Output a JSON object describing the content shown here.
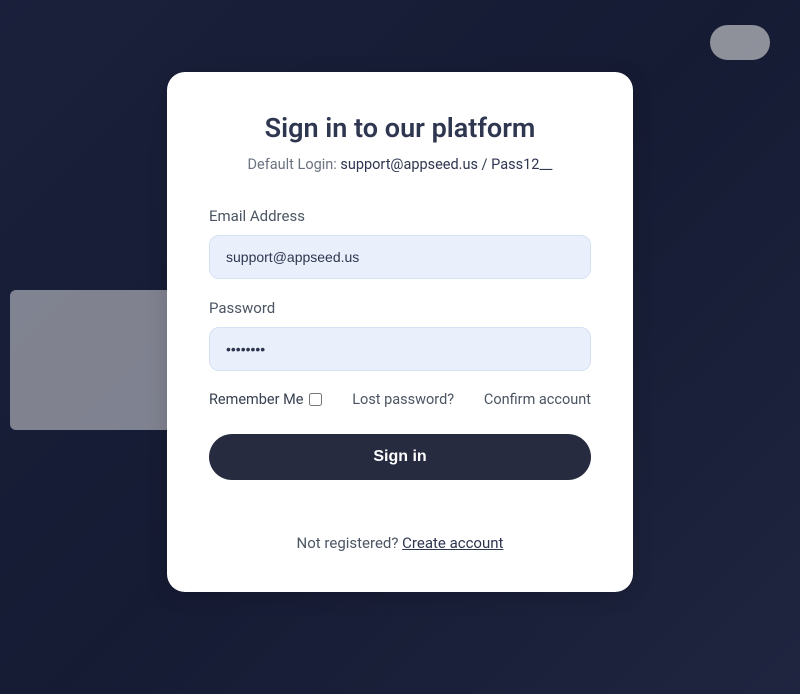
{
  "title": "Sign in to our platform",
  "subtitle_prefix": "Default Login: ",
  "subtitle_creds": "support@appseed.us / Pass12__",
  "email": {
    "label": "Email Address",
    "value": "support@appseed.us"
  },
  "password": {
    "label": "Password",
    "value": "••••••••"
  },
  "remember_label": "Remember Me",
  "lost_password": "Lost password?",
  "confirm_account": "Confirm account",
  "signin_button": "Sign in",
  "footer_text": "Not registered? ",
  "footer_link": "Create account",
  "colors": {
    "primary": "#262b40",
    "input_bg": "#eaf0fb",
    "text": "#2e3650"
  }
}
